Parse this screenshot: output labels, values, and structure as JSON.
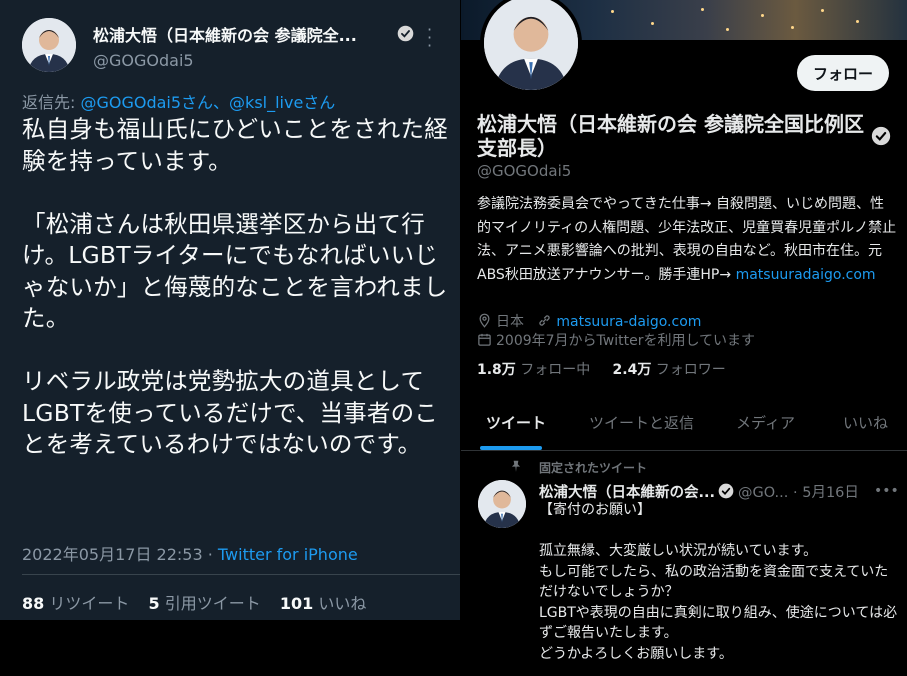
{
  "left_tweet": {
    "name": "松浦大悟（日本維新の会 参議院全...",
    "handle": "@GOGOdai5",
    "reply_prefix": "返信先: ",
    "reply_mentions": "@GOGOdai5さん、@ksl_liveさん",
    "text": "私自身も福山氏にひどいことをされた経験を持っています。\n\n「松浦さんは秋田県選挙区から出て行け。LGBTライターにでもなればいいじゃないか」と侮蔑的なことを言われました。\n\nリベラル政党は党勢拡大の道具としてLGBTを使っているだけで、当事者のことを考えているわけではないのです。",
    "timestamp": "2022年05月17日 22:53 · ",
    "source": "Twitter for iPhone",
    "retweets_count": "88",
    "retweets_label": "リツイート",
    "quotes_count": "5",
    "quotes_label": "引用ツイート",
    "likes_count": "101",
    "likes_label": "いいね"
  },
  "profile": {
    "follow_label": "フォロー",
    "name": "松浦大悟（日本維新の会 参議院全国比例区支部長）",
    "handle": "@GOGOdai5",
    "bio": "参議院法務委員会でやってきた仕事→ 自殺問題、いじめ問題、性的マイノリティの人権問題、少年法改正、児童買春児童ポルノ禁止法、アニメ悪影響論への批判、表現の自由など。秋田市在住。元ABS秋田放送アナウンサー。勝手連HP→ ",
    "bio_link": "matsuuradaigo.com",
    "location": "日本",
    "website": "matsuura-daigo.com",
    "joined": "2009年7月からTwitterを利用しています",
    "following_count": "1.8万",
    "following_label": "フォロー中",
    "followers_count": "2.4万",
    "followers_label": "フォロワー"
  },
  "tabs": [
    "ツイート",
    "ツイートと返信",
    "メディア",
    "いいね"
  ],
  "pinned_tweet": {
    "pinned_label": "固定されたツイート",
    "name": "松浦大悟（日本維新の会...",
    "handle_date": "@GO... · 5月16日",
    "text": "【寄付のお願い】\n\n孤立無縁、大変厳しい状況が続いています。\nもし可能でしたら、私の政治活動を資金面で支えていただけないでしょうか？\nLGBTや表現の自由に真剣に取り組み、使途については必ずご報告いたします。\nどうかよろしくお願いします。"
  },
  "colors": {
    "accent": "#1d9bf0",
    "dim_bg": "#15202b",
    "black_bg": "#000000"
  }
}
